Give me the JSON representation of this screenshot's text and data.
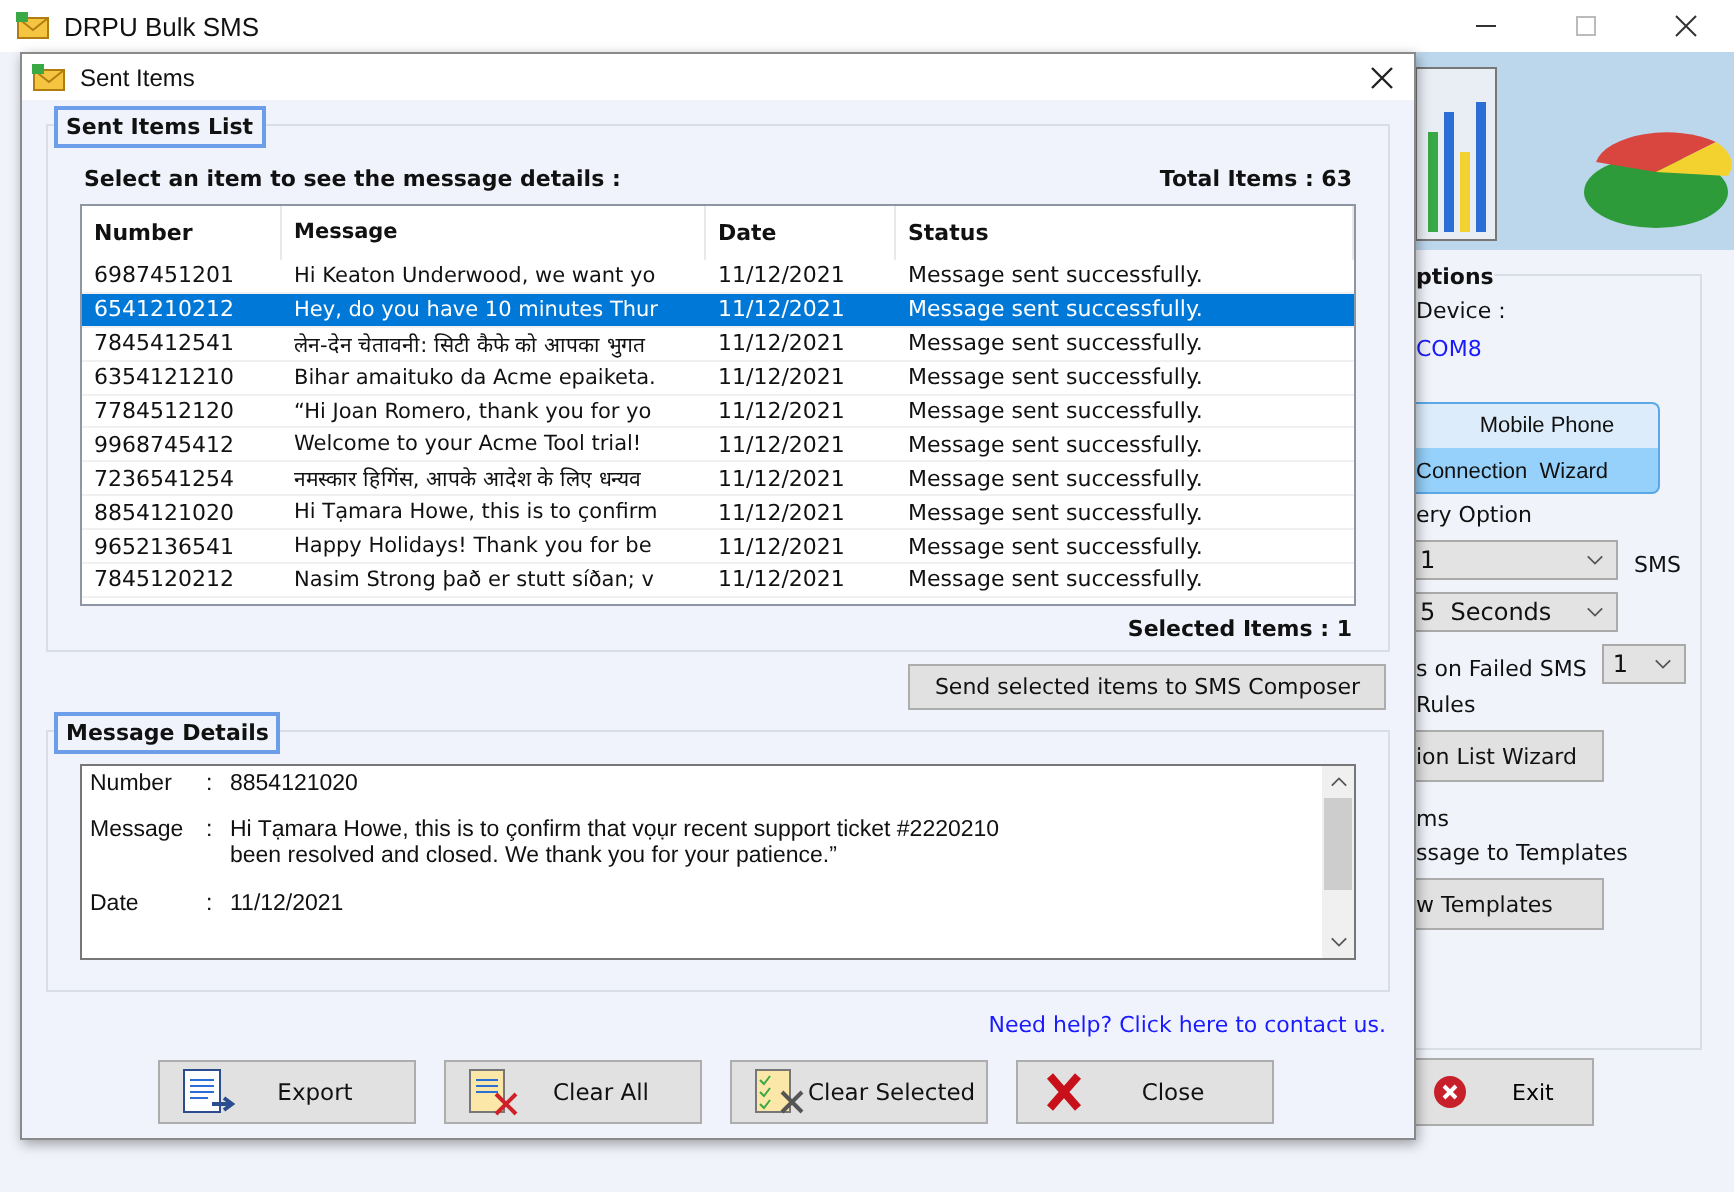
{
  "main_window": {
    "title": "DRPU Bulk SMS",
    "options": {
      "legend": "ptions",
      "device_label": "Device :",
      "port": "COM8",
      "wizard_button": [
        "Mobile Phone",
        "Connection  Wizard"
      ],
      "delivery_label": "ery Option",
      "sms_select": "1",
      "sms_label": "SMS",
      "delay_select": "5  Seconds",
      "failed_label": "s on Failed SMS",
      "failed_select": "1",
      "rules_label": "Rules",
      "list_wizard_button": "ion List Wizard",
      "items_label": "ms",
      "templates_label": "ssage to Templates",
      "templates_button": "w Templates"
    },
    "exit_button": "Exit"
  },
  "dialog": {
    "title": "Sent Items",
    "list_group": {
      "legend": "Sent Items List",
      "instruction": "Select an item to see the message details :",
      "total": "Total Items : 63",
      "columns": [
        "Number",
        "Message",
        "Date",
        "Status"
      ],
      "rows": [
        {
          "number": "6987451201",
          "message": "Hi Keaton Underwood, we want yo",
          "date": "11/12/2021",
          "status": "Message sent successfully.",
          "selected": false
        },
        {
          "number": "6541210212",
          "message": "Hey, do you have 10 minutes Thur",
          "date": "11/12/2021",
          "status": "Message sent successfully.",
          "selected": true
        },
        {
          "number": "7845412541",
          "message": "लेन-देन चेतावनी: सिटी कैफे को आपका भुगत",
          "date": "11/12/2021",
          "status": "Message sent successfully.",
          "selected": false
        },
        {
          "number": "6354121210",
          "message": "Bihar amaituko da Acme epaiketa.",
          "date": "11/12/2021",
          "status": "Message sent successfully.",
          "selected": false
        },
        {
          "number": "7784512120",
          "message": "“Hi Joan Romero, thank you for yo",
          "date": "11/12/2021",
          "status": "Message sent successfully.",
          "selected": false
        },
        {
          "number": "9968745412",
          "message": "Welcome to your Acme Tool trial!",
          "date": "11/12/2021",
          "status": "Message sent successfully.",
          "selected": false
        },
        {
          "number": "7236541254",
          "message": "नमस्कार  हिगिंस, आपके आदेश के लिए धन्यव",
          "date": "11/12/2021",
          "status": "Message sent successfully.",
          "selected": false
        },
        {
          "number": "8854121020",
          "message": "Hi Tạmara Howe, this is to çonfirm",
          "date": "11/12/2021",
          "status": "Message sent successfully.",
          "selected": false
        },
        {
          "number": "9652136541",
          "message": "Happy Holidays! Thank you for be",
          "date": "11/12/2021",
          "status": "Message sent successfully.",
          "selected": false
        },
        {
          "number": "7845120212",
          "message": "Nasim Strong það er stutt síðan; v",
          "date": "11/12/2021",
          "status": "Message sent successfully.",
          "selected": false
        }
      ],
      "selected_count": "Selected Items : 1"
    },
    "send_button": "Send selected items to SMS Composer",
    "details_group": {
      "legend": "Message Details",
      "fields": [
        {
          "label": "Number",
          "separator": ":",
          "lines": [
            "8854121020"
          ]
        },
        {
          "label": "Message",
          "separator": ":",
          "lines": [
            "Hi Tạmara Howe, this is to çonfirm that vọụr recent support ticket #2220210",
            "been resolved and closed. We thank you for your patience.”"
          ]
        },
        {
          "label": "Date",
          "separator": ":",
          "lines": [
            "11/12/2021"
          ]
        }
      ]
    },
    "help_link": "Need help? Click here to contact us.",
    "buttons": [
      {
        "label": "Export",
        "kind": "export"
      },
      {
        "label": "Clear All",
        "kind": "clear_all"
      },
      {
        "label": "Clear Selected",
        "kind": "clear_selected"
      },
      {
        "label": "Close",
        "kind": "close"
      }
    ]
  }
}
